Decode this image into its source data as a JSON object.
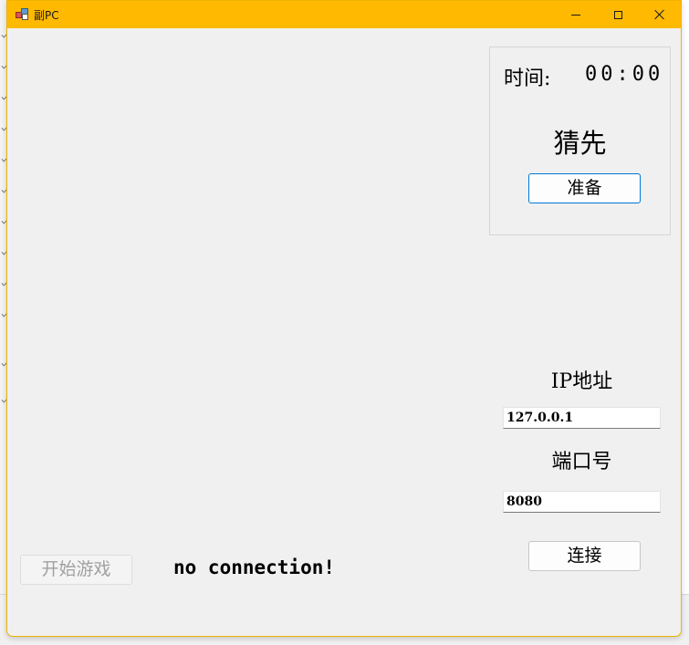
{
  "window": {
    "title": "副PC",
    "accent_color": "#ffb900",
    "title_icon": "app-icon"
  },
  "title_controls": {
    "minimize_icon": "minimize-icon",
    "maximize_icon": "maximize-icon",
    "close_icon": "close-icon"
  },
  "game_panel": {
    "time_label": "时间:",
    "time_value": "00:00",
    "turn_text": "猜先",
    "ready_button": "准备"
  },
  "connection": {
    "ip_label": "IP地址",
    "ip_value": "127.0.0.1",
    "port_label": "端口号",
    "port_value": "8080",
    "connect_button": "连接"
  },
  "footer": {
    "start_button": "开始游戏",
    "start_button_enabled": false,
    "status_text": "no connection!"
  }
}
